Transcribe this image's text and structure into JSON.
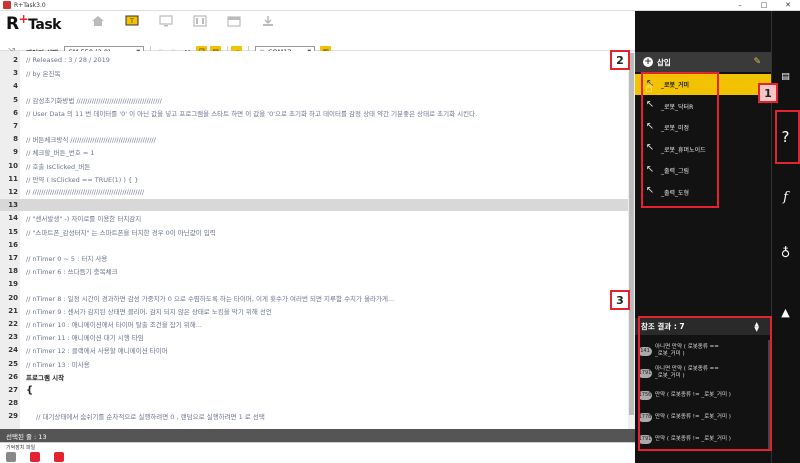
{
  "window": {
    "title": "R+Task3.0",
    "controls": [
      "–",
      "□",
      "✕"
    ]
  },
  "logo": {
    "r": "R",
    "plus": "+",
    "task": "Task"
  },
  "toolbar": {
    "controller_label": "제어기 선택",
    "controller_value": "CM-550 (2.0)",
    "port_value": "COM13"
  },
  "editor": {
    "lines": [
      {
        "n": "2",
        "t": "//    Released : 3 / 28 / 2019"
      },
      {
        "n": "3",
        "t": "//    by 온진목"
      },
      {
        "n": "4",
        "t": ""
      },
      {
        "n": "5",
        "t": "//    감성초기화방법 ///////////////////////////////////////"
      },
      {
        "n": "6",
        "t": "//    User Data 의 11 번 데이터를 '0' 이 아닌 값을 넣고 프로그램을 스타트 하면 이 값을 '0'으로 초기화 하고 데이터를 감정 상태 약간 기분좋은 상태로 초기화 시킨다."
      },
      {
        "n": "7",
        "t": ""
      },
      {
        "n": "8",
        "t": "//    버튼체크방식 ///////////////////////////////////////"
      },
      {
        "n": "9",
        "t": "//    체크할_버튼_번호 = 1"
      },
      {
        "n": "10",
        "t": "//    호출 IsClicked_버튼"
      },
      {
        "n": "11",
        "t": "//    만약 ( IsClicked == TRUE(1) ) { }"
      },
      {
        "n": "12",
        "t": "//    ///////////////////////////////////////////////////"
      },
      {
        "n": "13",
        "t": ""
      },
      {
        "n": "14",
        "t": "//    \"센서발생\" -) 자이로를 이용한 터치감지"
      },
      {
        "n": "15",
        "t": "//    \"스마트폰_감성터치\" 는 스마트폰을 터치한 경우 0이 아닌값이 입력"
      },
      {
        "n": "16",
        "t": ""
      },
      {
        "n": "17",
        "t": "//    nTimer 0 ~ 5 : 터치 사용"
      },
      {
        "n": "18",
        "t": "//    nTimer 6 : 쓰다듬기 충복체크"
      },
      {
        "n": "19",
        "t": ""
      },
      {
        "n": "20",
        "t": "//    nTimer 8 : 일정 시간이 경과하면 감성 가중치가 0 으로 수렴하도록 하는 타이머, 이게 횟수가 여러번 되면 지루함 수치가 올라가게..."
      },
      {
        "n": "21",
        "t": "//    nTimer 9 : 센서가 감지된 상태면 클리어. 감지 되지 않은 상태로 노킹을 막기 위해 선언"
      },
      {
        "n": "22",
        "t": "//    nTimer 10 : 애니메이션에서 타이머 탈출 조건을 잡기 위해..."
      },
      {
        "n": "23",
        "t": "//    nTimer 11 : 애니메이션 대기 시행 타임"
      },
      {
        "n": "24",
        "t": "//    nTimer 12 : 클랙에서 사용할 애니메이션 타이머"
      },
      {
        "n": "25",
        "t": "//    nTimer 13 : 미사용"
      },
      {
        "n": "26",
        "t": "프로그램 시작"
      },
      {
        "n": "27",
        "t": "{"
      },
      {
        "n": "28",
        "t": ""
      },
      {
        "n": "29",
        "t": "//    대기상태에서 숨쉬기를 순차적으로 실행하려면 0 , 랜덤으로 실행하려면 1 로 선택"
      }
    ]
  },
  "status": {
    "selected_line": "선택된 줄 : 13"
  },
  "bottom": {
    "label": "기억장치 파일"
  },
  "insert_panel": {
    "title": "삽입",
    "items": [
      "_로봇_거미",
      "_로봇_닥터R",
      "_로봇_미정",
      "_로봇_휴머노이드",
      "_출력_그림",
      "_출력_도형"
    ]
  },
  "ref_panel": {
    "title": "참조 결과 : 7",
    "items": [
      {
        "badge": "141",
        "l1": "아니면 만약 ( 로봇종류 ==",
        "l2": "_로봇_거미 )"
      },
      {
        "badge": "1791",
        "l1": "아니면 만약 ( 로봇종류 ==",
        "l2": "_로봇_거미 )"
      },
      {
        "badge": "1756",
        "l1": "만약 ( 로봇종류 != _로봇_거미 )",
        "l2": ""
      },
      {
        "badge": "1778",
        "l1": "만약 ( 로봇종류 != _로봇_거미 )",
        "l2": ""
      },
      {
        "badge": "1791",
        "l1": "만약 ( 로봇종류 != _로봇_거미 )",
        "l2": ""
      }
    ]
  },
  "annotations": {
    "one": "1",
    "two": "2",
    "three": "3"
  },
  "rail": {
    "help": "?",
    "func": "f"
  },
  "colors": {
    "accent": "#f2c200",
    "annotation": "#e32430"
  }
}
